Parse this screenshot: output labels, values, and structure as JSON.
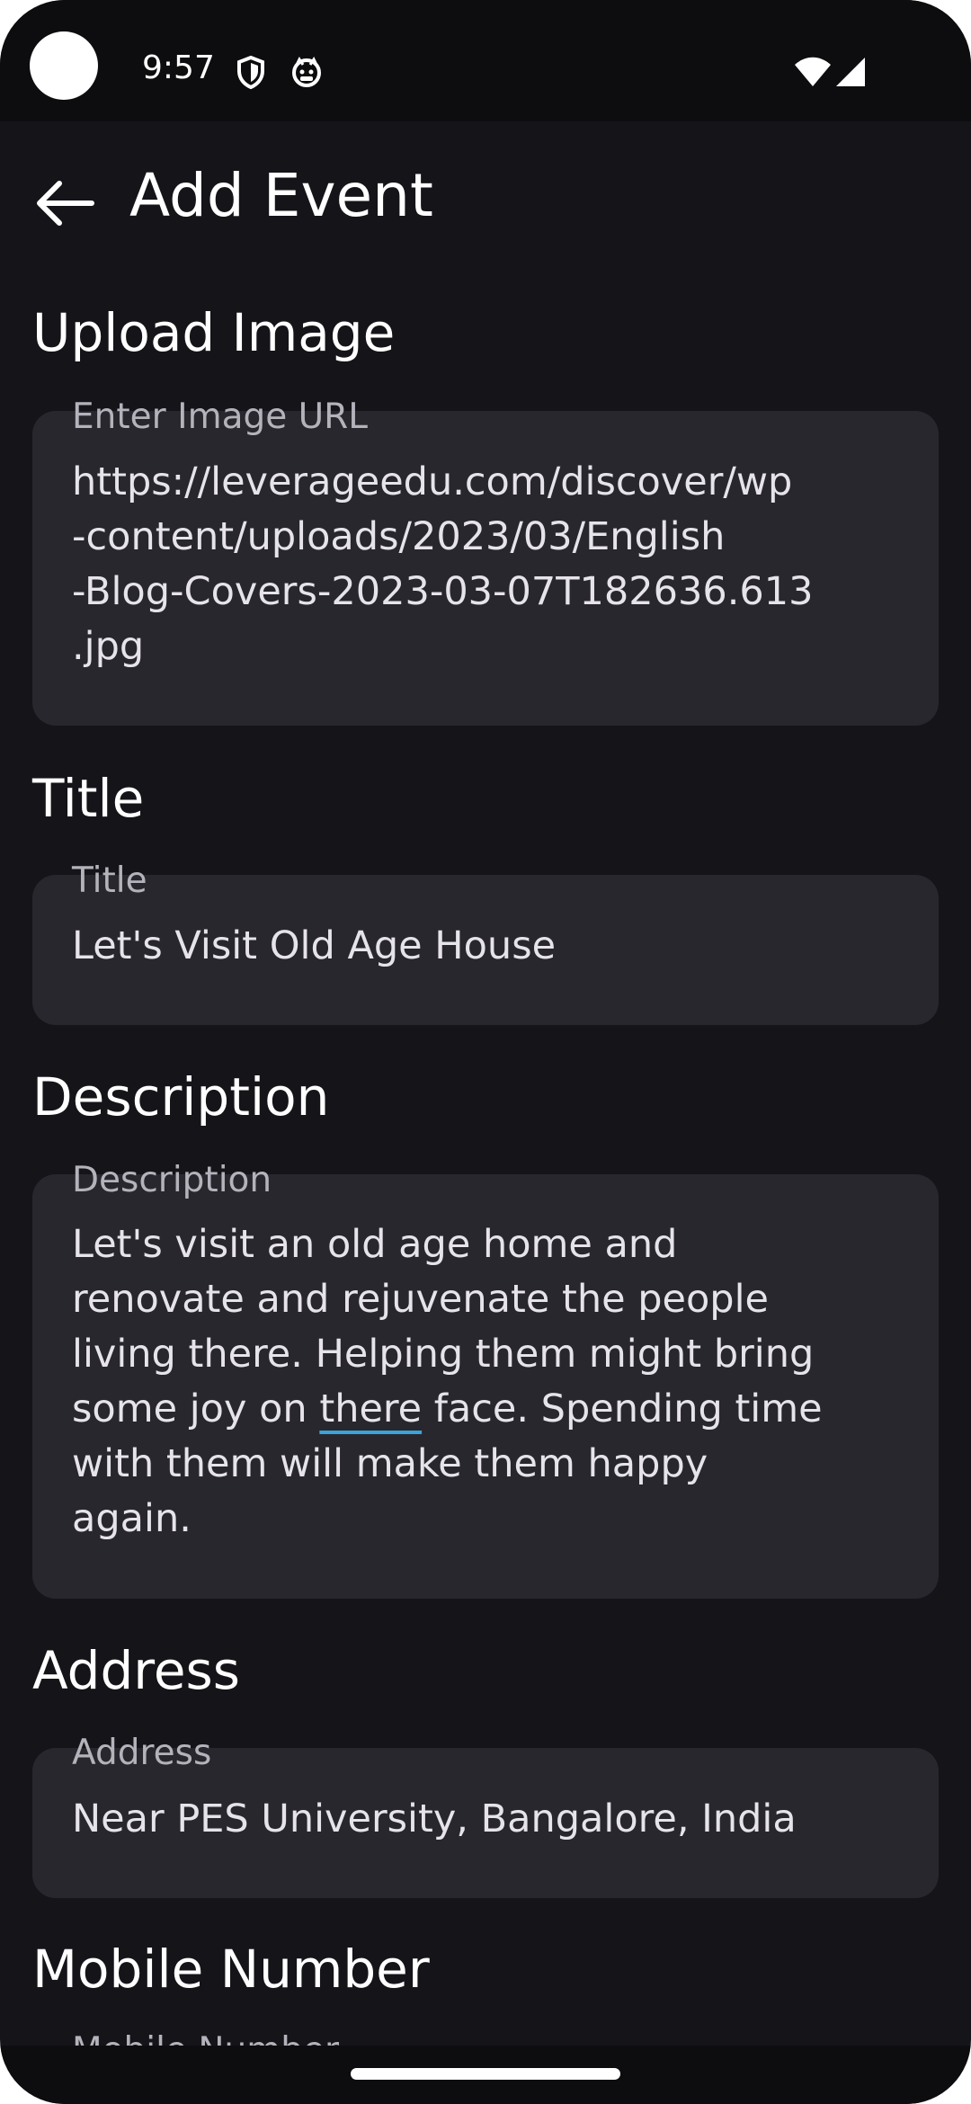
{
  "status_bar": {
    "time": "9:57",
    "icons": [
      "shield-icon",
      "face-icon",
      "wifi-icon",
      "signal-icon"
    ]
  },
  "header": {
    "back_icon": "arrow-left-icon",
    "title": "Add Event"
  },
  "sections": {
    "image": {
      "heading": "Upload Image",
      "label": "Enter Image URL",
      "value": "https://leverageedu.com/discover/wp\n-content/uploads/2023/03/English\n-Blog-Covers-2023-03-07T182636.613\n.jpg"
    },
    "title": {
      "heading": "Title",
      "label": "Title",
      "value": "Let's Visit Old Age House"
    },
    "description": {
      "heading": "Description",
      "label": "Description",
      "value_part1": "Let's visit an old age home and\nrenovate and rejuvenate the people\nliving there. Helping them might bring\nsome joy on ",
      "value_misspelled": "there",
      "value_part2": " face. Spending time\nwith them will make them happy\nagain."
    },
    "address": {
      "heading": "Address",
      "label": "Address",
      "value": "Near PES University, Bangalore, India"
    },
    "mobile": {
      "heading": "Mobile Number",
      "label": "Mobile Number"
    }
  },
  "colors": {
    "background": "#151419",
    "field_background": "#28272d",
    "spellcheck_underline": "#3aa3d8"
  }
}
